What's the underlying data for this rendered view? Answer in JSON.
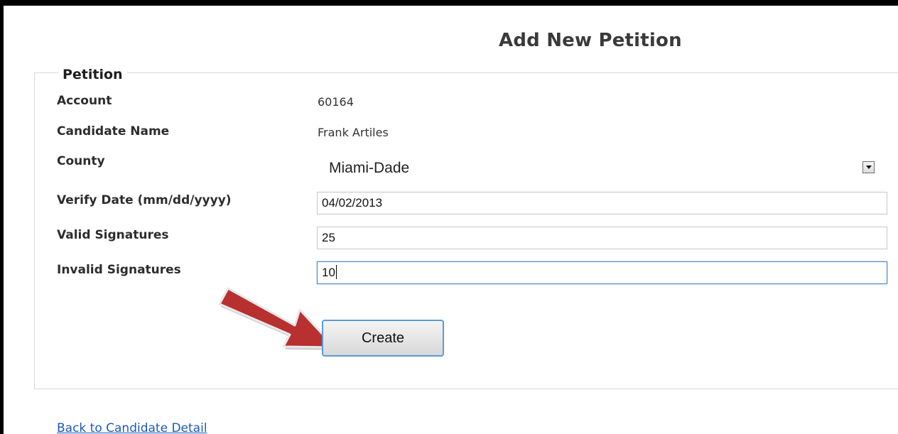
{
  "page": {
    "title": "Add New Petition"
  },
  "petition": {
    "legend": "Petition",
    "account_label": "Account",
    "account_value": "60164",
    "candidate_label": "Candidate Name",
    "candidate_value": "Frank Artiles",
    "county_label": "County",
    "county_value": "Miami-Dade",
    "verify_date_label": "Verify Date (mm/dd/yyyy)",
    "verify_date_value": "04/02/2013",
    "valid_label": "Valid Signatures",
    "valid_value": "25",
    "invalid_label": "Invalid Signatures",
    "invalid_value": "10",
    "create_label": "Create"
  },
  "footer": {
    "back_link": "Back to Candidate Detail"
  },
  "colors": {
    "link": "#1c59b5",
    "focus_border": "#4b86c7",
    "annotation_arrow": "#b8302f"
  },
  "icons": {
    "dropdown": "chevron-down-icon",
    "annotation": "red-arrow-icon"
  }
}
